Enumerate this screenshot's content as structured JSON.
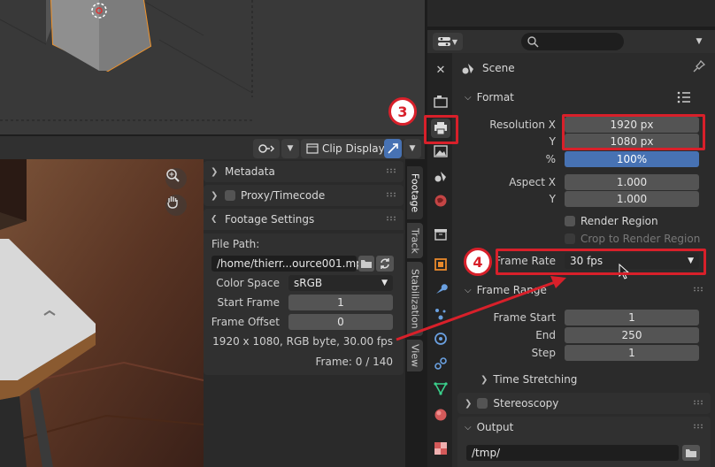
{
  "clip_editor": {
    "header": {
      "display_label": "Clip Display"
    },
    "panels": {
      "metadata": "Metadata",
      "proxy": "Proxy/Timecode",
      "footage_settings": "Footage Settings"
    },
    "footage": {
      "file_path_label": "File Path:",
      "file_path_value": "/home/thierr...ource001.mp4",
      "color_space_label": "Color Space",
      "color_space_value": "sRGB",
      "start_frame_label": "Start Frame",
      "start_frame_value": "1",
      "frame_offset_label": "Frame Offset",
      "frame_offset_value": "0",
      "info_line": "1920 x 1080, RGB byte, 30.00 fps",
      "frame_line": "Frame: 0 / 140"
    },
    "tabs": [
      "Footage",
      "Track",
      "Stabilization",
      "View"
    ]
  },
  "properties": {
    "context_title": "Scene",
    "format": {
      "title": "Format",
      "resolution_x_label": "Resolution X",
      "resolution_x_value": "1920 px",
      "resolution_y_label": "Y",
      "resolution_y_value": "1080 px",
      "percent_label": "%",
      "percent_value": "100%",
      "percent_fill": 1.0,
      "aspect_x_label": "Aspect X",
      "aspect_x_value": "1.000",
      "aspect_y_label": "Y",
      "aspect_y_value": "1.000",
      "render_region": "Render Region",
      "crop_region": "Crop to Render Region",
      "frame_rate_label": "Frame Rate",
      "frame_rate_value": "30 fps"
    },
    "frame_range": {
      "title": "Frame Range",
      "start_label": "Frame Start",
      "start_value": "1",
      "end_label": "End",
      "end_value": "250",
      "step_label": "Step",
      "step_value": "1"
    },
    "time_stretching": "Time Stretching",
    "stereoscopy": "Stereoscopy",
    "output": {
      "title": "Output",
      "path": "/tmp/"
    }
  },
  "annotations": {
    "step3": "3",
    "step4": "4"
  },
  "colors": {
    "annotation": "#d8202a",
    "accent_blue": "#4772b3",
    "object_orange": "#f0932b"
  }
}
